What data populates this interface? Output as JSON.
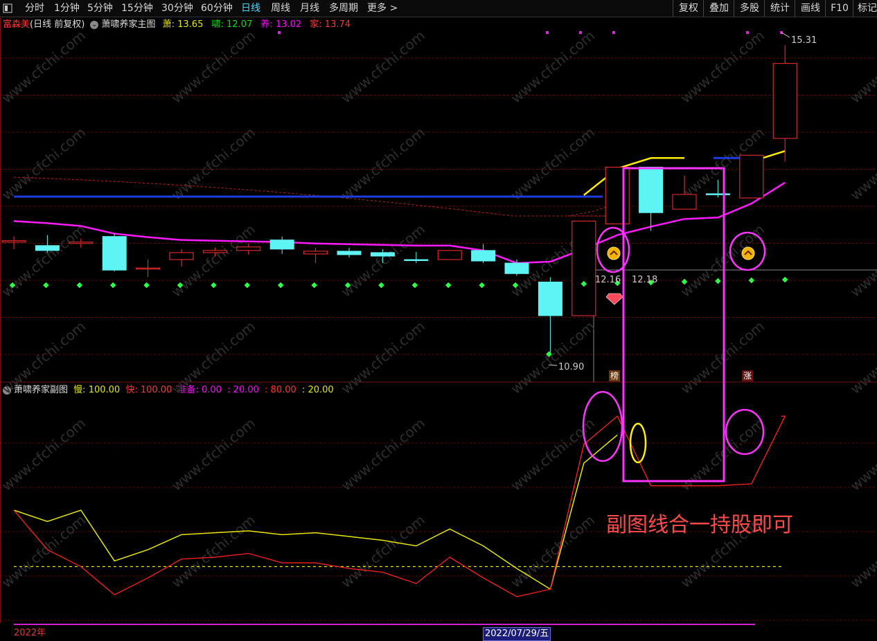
{
  "toolbar": {
    "toggle_icon": "panel-toggle-icon",
    "periods": [
      "分时",
      "1分钟",
      "5分钟",
      "15分钟",
      "30分钟",
      "60分钟",
      "日线",
      "周线",
      "月线",
      "多周期",
      "更多"
    ],
    "active_period": "日线",
    "more_arrow": ">",
    "right_buttons": [
      "复权",
      "叠加",
      "多股",
      "统计",
      "画线",
      "F10",
      "标记"
    ]
  },
  "main_panel": {
    "stock_name": "富森美",
    "mode": "(日线 前复权)",
    "indicator_name": "萧啸养家主图",
    "values": [
      {
        "label": "萧:",
        "value": "13.65",
        "color": "#e6e600"
      },
      {
        "label": "啸:",
        "value": "12.07",
        "color": "#00e000"
      },
      {
        "label": "养:",
        "value": "13.02",
        "color": "#ff00ff"
      },
      {
        "label": "家:",
        "value": "13.74",
        "color": "#ff3333"
      }
    ],
    "price_labels": {
      "high": "15.31",
      "low": "10.90",
      "mid_left": "12.16",
      "mid_right": "12.18"
    },
    "tags": {
      "bang": "榜",
      "zhang": "涨"
    }
  },
  "sub_panel": {
    "indicator_name": "萧啸养家副图",
    "values": [
      {
        "label": "慢:",
        "value": "100.00",
        "color": "#e6e600"
      },
      {
        "label": "快:",
        "value": "100.00",
        "color": "#ff3333"
      },
      {
        "label": "准备:",
        "value": "0.00",
        "color": "#ff00ff"
      },
      {
        "label": ":",
        "value": "20.00",
        "color": "#ff00ff"
      },
      {
        "label": ":",
        "value": "80.00",
        "color": "#ff3333"
      },
      {
        "label": ":",
        "value": "20.00",
        "color": "#e6e600"
      }
    ],
    "annotation": "副图线合一持股即可"
  },
  "watermark": "www.cfchi.com",
  "axis": {
    "year": "2022年",
    "cursor_date": "2022/07/29/五"
  },
  "chart_data": {
    "type": "candlestick",
    "price_ylim": [
      10.6,
      15.6
    ],
    "candles": [
      {
        "o": 12.5,
        "h": 12.58,
        "l": 12.4,
        "c": 12.52
      },
      {
        "o": 12.45,
        "h": 12.6,
        "l": 12.35,
        "c": 12.38
      },
      {
        "o": 12.48,
        "h": 12.55,
        "l": 12.42,
        "c": 12.5
      },
      {
        "o": 12.58,
        "h": 12.62,
        "l": 12.08,
        "c": 12.1
      },
      {
        "o": 12.12,
        "h": 12.25,
        "l": 12.0,
        "c": 12.13
      },
      {
        "o": 12.25,
        "h": 12.4,
        "l": 12.15,
        "c": 12.35
      },
      {
        "o": 12.35,
        "h": 12.42,
        "l": 12.3,
        "c": 12.38
      },
      {
        "o": 12.38,
        "h": 12.48,
        "l": 12.32,
        "c": 12.43
      },
      {
        "o": 12.53,
        "h": 12.58,
        "l": 12.33,
        "c": 12.4
      },
      {
        "o": 12.33,
        "h": 12.42,
        "l": 12.2,
        "c": 12.37
      },
      {
        "o": 12.37,
        "h": 12.42,
        "l": 12.28,
        "c": 12.32
      },
      {
        "o": 12.35,
        "h": 12.4,
        "l": 12.2,
        "c": 12.3
      },
      {
        "o": 12.25,
        "h": 12.36,
        "l": 12.2,
        "c": 12.24
      },
      {
        "o": 12.25,
        "h": 12.38,
        "l": 12.25,
        "c": 12.38
      },
      {
        "o": 12.38,
        "h": 12.47,
        "l": 12.2,
        "c": 12.23
      },
      {
        "o": 12.2,
        "h": 12.25,
        "l": 12.02,
        "c": 12.05
      },
      {
        "o": 11.93,
        "h": 12.0,
        "l": 10.9,
        "c": 11.45
      },
      {
        "o": 11.45,
        "h": 12.8,
        "l": 11.45,
        "c": 12.8
      },
      {
        "o": 12.76,
        "h": 13.57,
        "l": 12.76,
        "c": 13.57
      },
      {
        "o": 13.57,
        "h": 13.57,
        "l": 12.66,
        "c": 12.92
      },
      {
        "o": 12.97,
        "h": 13.45,
        "l": 12.97,
        "c": 13.18
      },
      {
        "o": 13.19,
        "h": 13.39,
        "l": 13.14,
        "c": 13.18
      },
      {
        "o": 13.13,
        "h": 13.74,
        "l": 13.13,
        "c": 13.74
      },
      {
        "o": 13.98,
        "h": 15.31,
        "l": 13.65,
        "c": 15.05
      }
    ],
    "magenta_line": [
      12.8,
      12.77,
      12.73,
      12.62,
      12.57,
      12.53,
      12.52,
      12.51,
      12.5,
      12.48,
      12.47,
      12.46,
      12.45,
      12.45,
      12.38,
      12.2,
      12.22,
      12.4,
      12.6,
      12.72,
      12.83,
      12.85,
      13.05,
      13.35
    ],
    "blue_line_level": 13.15,
    "yellow_line": [
      13.17,
      13.55,
      13.7,
      13.7,
      13.7,
      13.65,
      13.8
    ],
    "sub_ylim": [
      -10,
      110
    ],
    "slow_line": [
      50,
      44,
      50,
      23,
      29,
      37,
      38,
      39,
      37,
      38,
      36,
      34,
      31,
      40,
      31,
      19,
      8,
      75,
      90,
      71,
      70,
      70,
      72,
      100
    ],
    "fast_line": [
      50,
      29,
      20,
      5,
      14,
      24,
      25,
      27,
      22,
      22,
      19,
      17,
      11,
      25,
      14,
      4,
      8,
      85,
      100,
      63,
      63,
      63,
      64,
      100
    ],
    "sub_dashed": [
      20,
      80
    ]
  }
}
